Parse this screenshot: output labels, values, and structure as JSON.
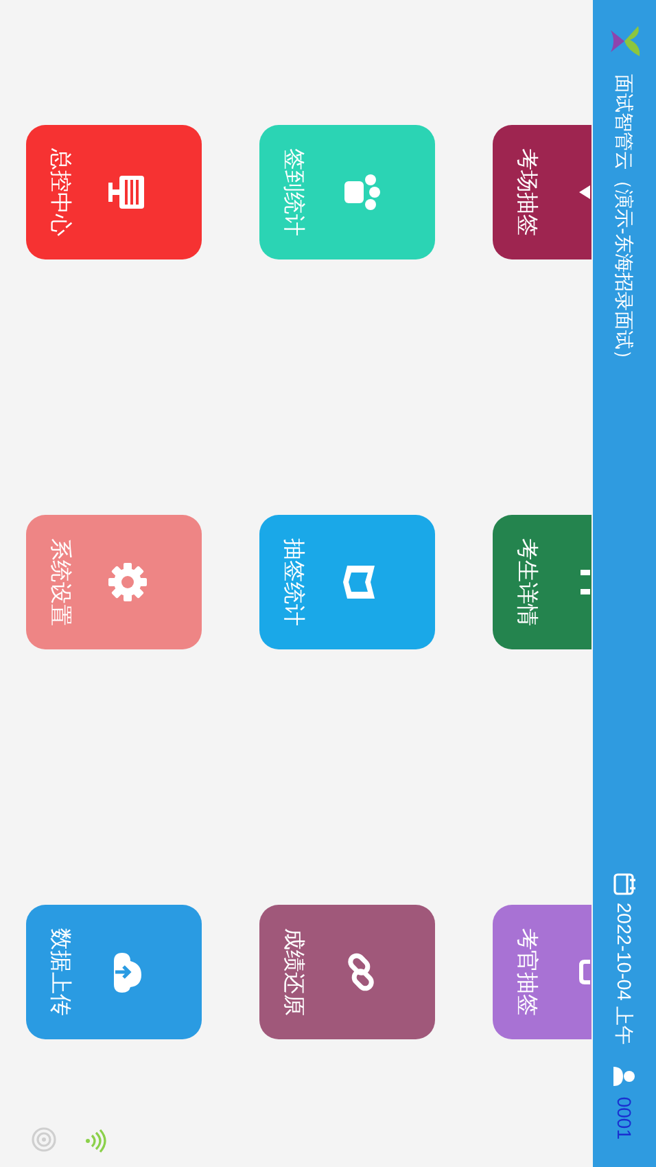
{
  "header": {
    "title": "面试智管云（演示-东海招录面试）",
    "date": "2022-10-04 上午",
    "user_id": "0001"
  },
  "tiles": [
    {
      "label": "考场抽签",
      "color": "#9e2550"
    },
    {
      "label": "考生详情",
      "color": "#24844e"
    },
    {
      "label": "考官抽签",
      "color": "#a872d4"
    },
    {
      "label": "签到统计",
      "color": "#2bd4b4"
    },
    {
      "label": "抽签统计",
      "color": "#1aa8e8"
    },
    {
      "label": "成绩还原",
      "color": "#a0587a"
    },
    {
      "label": "总控中心",
      "color": "#f63232"
    },
    {
      "label": "系统设置",
      "color": "#ee8585"
    },
    {
      "label": "数据上传",
      "color": "#2a9be2"
    }
  ]
}
